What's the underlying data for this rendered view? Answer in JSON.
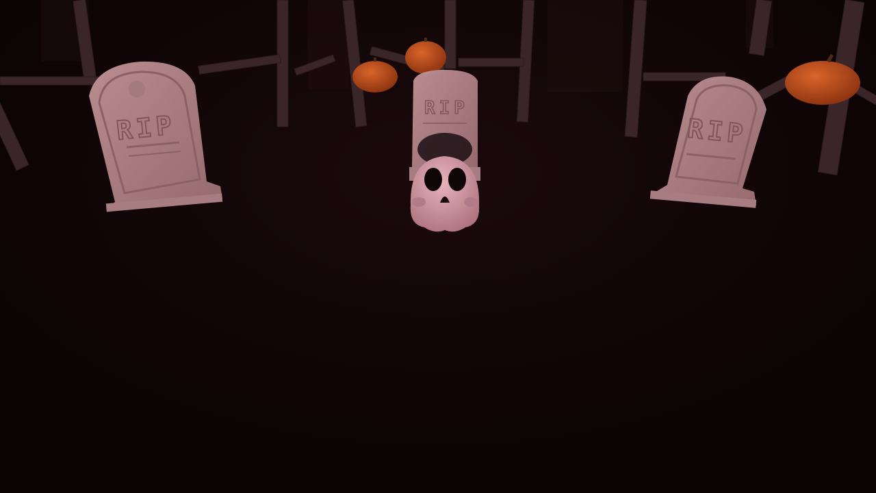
{
  "scene": {
    "theme": "graveyard",
    "ambient_color": "#0d0405",
    "tombstone_color": "#b88a8f",
    "pumpkin_color": "#c2501f",
    "ghost_color": "#d39aa5"
  },
  "tombstones": [
    {
      "id": "left",
      "engraving": "RIP"
    },
    {
      "id": "center",
      "engraving": "RIP"
    },
    {
      "id": "right",
      "engraving": "RIP"
    }
  ],
  "pumpkins": [
    {
      "id": "pumpkin-1"
    },
    {
      "id": "pumpkin-2"
    },
    {
      "id": "pumpkin-3"
    }
  ],
  "player": {
    "character": "ghost"
  }
}
